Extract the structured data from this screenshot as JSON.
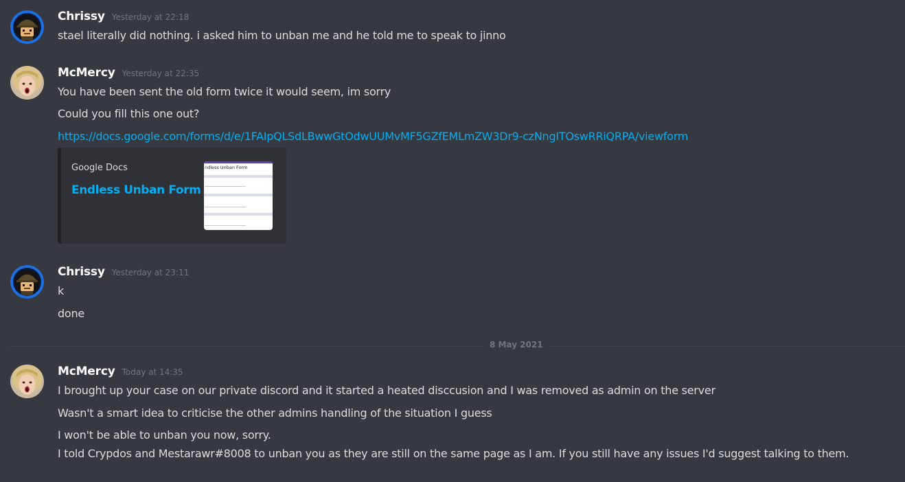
{
  "messages": [
    {
      "author": "Chrissy",
      "timestamp": "Yesterday at 22:18",
      "avatar": "lego-soldier-avatar",
      "lines": [
        "stael literally did nothing.  i asked him to unban me and he told me to speak to jinno"
      ]
    },
    {
      "author": "McMercy",
      "timestamp": "Yesterday at 22:35",
      "avatar": "surprised-woman-avatar",
      "lines": [
        "You have been sent the old form twice it would seem, im sorry",
        "Could you fill this one out?"
      ],
      "link": "https://docs.google.com/forms/d/e/1FAIpQLSdLBwwGtOdwUUMvMF5GZfEMLmZW3Dr9-czNngITOswRRiQRPA/viewform",
      "embed": {
        "provider": "Google Docs",
        "title": "Endless Unban Form",
        "thumbnail_title": "ndless Unban Form"
      }
    },
    {
      "author": "Chrissy",
      "timestamp": "Yesterday at 23:11",
      "avatar": "lego-soldier-avatar",
      "lines": [
        "k",
        "done"
      ]
    },
    {
      "author": "McMercy",
      "timestamp": "Today at 14:35",
      "avatar": "surprised-woman-avatar",
      "lines": [
        "I brought up your case on our private discord and it started a heated disccusion and I was removed as admin on the server",
        "Wasn't a smart idea to criticise the other admins handling of the situation I guess",
        "I won't be able to unban you now, sorry.",
        "I told Crypdos and Mestarawr#8008 to unban you as they are still on the same page as I am. If you still have any issues I'd suggest talking to them."
      ]
    }
  ],
  "date_divider": "8 May 2021",
  "colors": {
    "background": "#36393f",
    "text": "#dcddde",
    "username": "#ffffff",
    "timestamp": "#72767d",
    "link": "#00aff4",
    "embed_background": "#2f3136",
    "avatar_ring": "#1e6fe0"
  }
}
